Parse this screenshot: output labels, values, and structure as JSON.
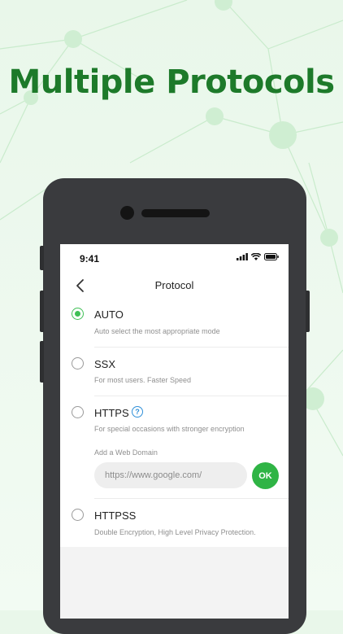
{
  "headline": "Multiple Protocols",
  "colors": {
    "accent": "#2fb445",
    "headline": "#1d7a2a",
    "help": "#2f8fd8"
  },
  "status_bar": {
    "time": "9:41",
    "icons": [
      "signal-icon",
      "wifi-icon",
      "battery-icon"
    ]
  },
  "nav": {
    "title": "Protocol",
    "back_icon": "chevron-left-icon"
  },
  "options": [
    {
      "label": "AUTO",
      "description": "Auto select the most appropriate mode",
      "selected": true
    },
    {
      "label": "SSX",
      "description": "For most users. Faster Speed",
      "selected": false
    },
    {
      "label": "HTTPS",
      "description": "For special occasions with stronger encryption",
      "selected": false
    },
    {
      "label": "HTTPSS",
      "description": "Double Encryption, High Level Privacy Protection.",
      "selected": false
    }
  ],
  "https_help_icon": "?",
  "domain": {
    "label": "Add a Web Domain",
    "placeholder": "https://www.google.com/",
    "value": "",
    "ok_label": "OK"
  }
}
